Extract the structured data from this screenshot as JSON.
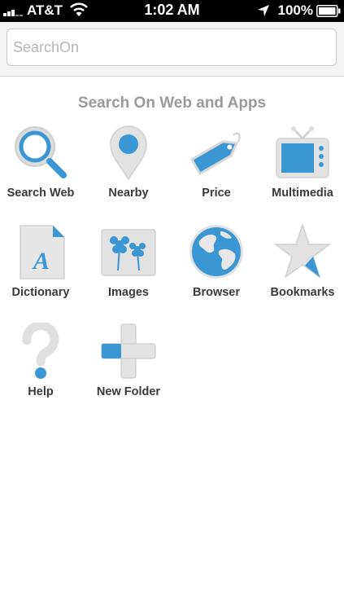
{
  "status_bar": {
    "carrier": "AT&T",
    "time": "1:02 AM",
    "battery": "100%"
  },
  "search": {
    "placeholder": "SearchOn",
    "value": ""
  },
  "section_title": "Search On Web and Apps",
  "colors": {
    "accent": "#3a97d4",
    "icon_gray": "#e2e2e2",
    "label": "#3a3a3a"
  },
  "apps": [
    {
      "label": "Search Web",
      "icon": "magnifier-icon"
    },
    {
      "label": "Nearby",
      "icon": "map-pin-icon"
    },
    {
      "label": "Price",
      "icon": "price-tag-icon"
    },
    {
      "label": "Multimedia",
      "icon": "tv-icon"
    },
    {
      "label": "Dictionary",
      "icon": "dictionary-icon"
    },
    {
      "label": "Images",
      "icon": "images-icon"
    },
    {
      "label": "Browser",
      "icon": "globe-icon"
    },
    {
      "label": "Bookmarks",
      "icon": "star-icon"
    },
    {
      "label": "Help",
      "icon": "question-mark-icon"
    },
    {
      "label": "New Folder",
      "icon": "plus-icon"
    }
  ]
}
